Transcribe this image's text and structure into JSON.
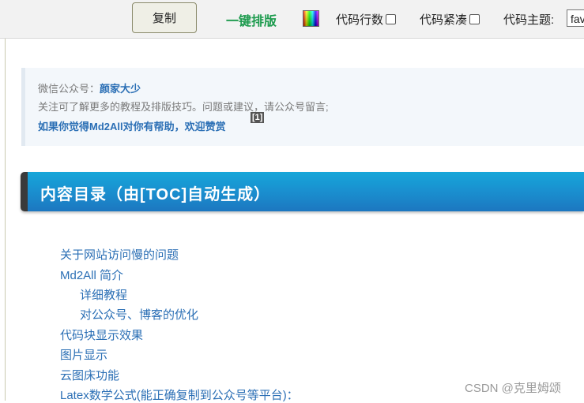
{
  "toolbar": {
    "copy_label": "复制",
    "format_label": "一键排版",
    "color_icon": "color-palette-icon",
    "line_numbers_label": "代码行数",
    "compact_label": "代码紧凑",
    "theme_label": "代码主题:",
    "theme_value": "fav"
  },
  "intro": {
    "wechat_prefix": "微信公众号：",
    "wechat_name": "颜家大少",
    "line2": "关注可了解更多的教程及排版技巧。问题或建议，请公众号留言;",
    "line3": "如果你觉得Md2All对你有帮助，欢迎赞赏",
    "footnote": "[1]"
  },
  "toc": {
    "title": "内容目录（由[TOC]自动生成）",
    "items": [
      "关于网站访问慢的问题",
      "Md2All 简介",
      "详细教程",
      "对公众号、博客的优化",
      "代码块显示效果",
      "图片显示",
      "云图床功能",
      "Latex数学公式(能正确复制到公众号等平台)："
    ]
  },
  "watermark": "CSDN @克里姆颂",
  "colors": {
    "accent_green": "#1d9b4e",
    "link_blue": "#2b6fb5",
    "heading_blue": "#1a8fcf"
  }
}
